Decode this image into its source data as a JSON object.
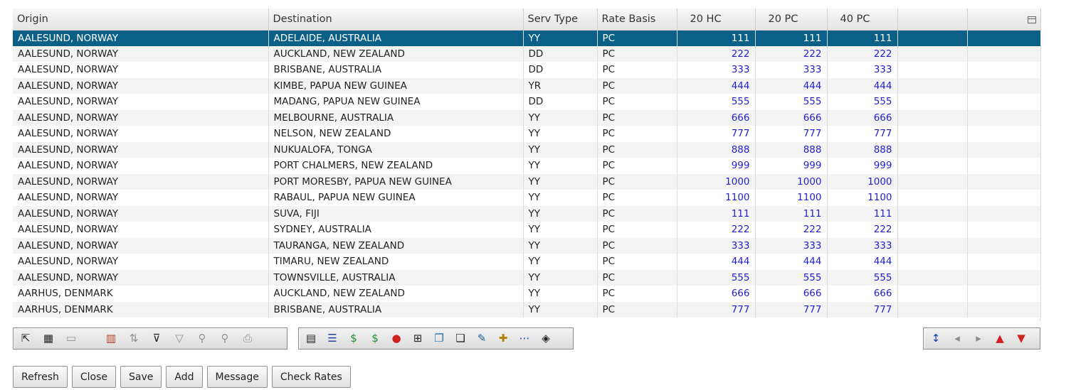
{
  "grid": {
    "columns": [
      "Origin",
      "Destination",
      "Serv Type",
      "Rate Basis",
      "20  HC",
      "20  PC",
      "40  PC",
      "",
      ""
    ],
    "rows": [
      [
        "AALESUND, NORWAY",
        "ADELAIDE, AUSTRALIA",
        "YY",
        "PC",
        "111",
        "111",
        "111"
      ],
      [
        "AALESUND, NORWAY",
        "AUCKLAND, NEW ZEALAND",
        "DD",
        "PC",
        "222",
        "222",
        "222"
      ],
      [
        "AALESUND, NORWAY",
        "BRISBANE, AUSTRALIA",
        "DD",
        "PC",
        "333",
        "333",
        "333"
      ],
      [
        "AALESUND, NORWAY",
        "KIMBE, PAPUA NEW GUINEA",
        "YR",
        "PC",
        "444",
        "444",
        "444"
      ],
      [
        "AALESUND, NORWAY",
        "MADANG, PAPUA NEW GUINEA",
        "DD",
        "PC",
        "555",
        "555",
        "555"
      ],
      [
        "AALESUND, NORWAY",
        "MELBOURNE, AUSTRALIA",
        "YY",
        "PC",
        "666",
        "666",
        "666"
      ],
      [
        "AALESUND, NORWAY",
        "NELSON, NEW ZEALAND",
        "YY",
        "PC",
        "777",
        "777",
        "777"
      ],
      [
        "AALESUND, NORWAY",
        "NUKUALOFA, TONGA",
        "YY",
        "PC",
        "888",
        "888",
        "888"
      ],
      [
        "AALESUND, NORWAY",
        "PORT CHALMERS, NEW ZEALAND",
        "YY",
        "PC",
        "999",
        "999",
        "999"
      ],
      [
        "AALESUND, NORWAY",
        "PORT MORESBY, PAPUA NEW GUINEA",
        "YY",
        "PC",
        "1000",
        "1000",
        "1000"
      ],
      [
        "AALESUND, NORWAY",
        "RABAUL, PAPUA NEW GUINEA",
        "YY",
        "PC",
        "1100",
        "1100",
        "1100"
      ],
      [
        "AALESUND, NORWAY",
        "SUVA, FIJI",
        "YY",
        "PC",
        "111",
        "111",
        "111"
      ],
      [
        "AALESUND, NORWAY",
        "SYDNEY, AUSTRALIA",
        "YY",
        "PC",
        "222",
        "222",
        "222"
      ],
      [
        "AALESUND, NORWAY",
        "TAURANGA, NEW ZEALAND",
        "YY",
        "PC",
        "333",
        "333",
        "333"
      ],
      [
        "AALESUND, NORWAY",
        "TIMARU, NEW ZEALAND",
        "YY",
        "PC",
        "444",
        "444",
        "444"
      ],
      [
        "AALESUND, NORWAY",
        "TOWNSVILLE, AUSTRALIA",
        "YY",
        "PC",
        "555",
        "555",
        "555"
      ],
      [
        "AARHUS, DENMARK",
        "AUCKLAND, NEW ZEALAND",
        "YY",
        "PC",
        "666",
        "666",
        "666"
      ],
      [
        "AARHUS, DENMARK",
        "BRISBANE, AUSTRALIA",
        "YY",
        "PC",
        "777",
        "777",
        "777"
      ]
    ],
    "selected_row": 0,
    "colors": {
      "selected": "#0b6088",
      "numeric": "#1f1fd0",
      "alt_row": "#f3f3f3"
    }
  },
  "toolbar_left": [
    "sort-icon",
    "table-view-icon",
    "blank-view-icon",
    "columns-icon",
    "sort-az-icon",
    "edit-filter-icon",
    "filter-icon",
    "find-icon",
    "find-next-icon",
    "print-icon"
  ],
  "toolbar_middle": [
    "properties-icon",
    "list-icon",
    "edit-rate-icon",
    "add-rate-icon",
    "apple-icon",
    "hierarchy-icon",
    "copy-icon",
    "windows-icon",
    "notes-icon",
    "add-item-icon",
    "insert-rows-icon",
    "tag-icon"
  ],
  "toolbar_right": [
    "row-height-icon",
    "page-prev-icon",
    "page-next-icon",
    "export-up-icon",
    "export-down-icon"
  ],
  "actions": {
    "refresh": "Refresh",
    "close": "Close",
    "save": "Save",
    "add": "Add",
    "message": "Message",
    "check_rates": "Check Rates"
  }
}
